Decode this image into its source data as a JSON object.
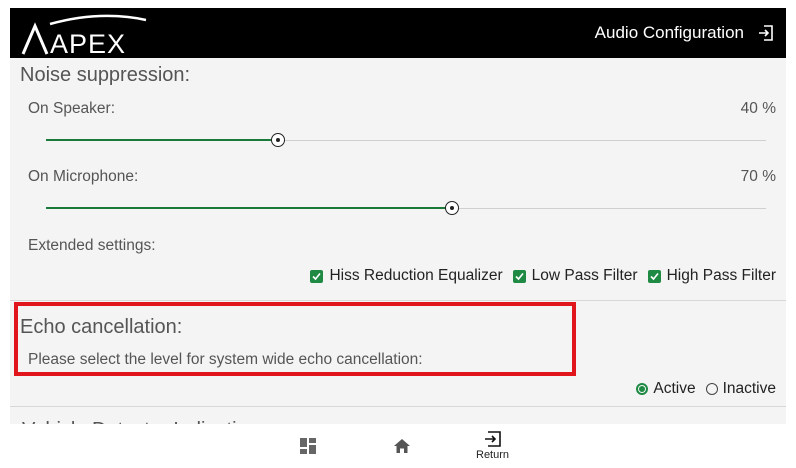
{
  "header": {
    "logo_text": "APEX",
    "title": "Audio Configuration",
    "exit_icon": "exit-icon"
  },
  "noise_suppression": {
    "title": "Noise suppression:",
    "speaker": {
      "label": "On Speaker:",
      "value_text": "40 %",
      "level": 0.4
    },
    "microphone": {
      "label": "On Microphone:",
      "value_text": "70 %",
      "level": 0.7
    },
    "extended_label": "Extended settings:",
    "options": [
      {
        "label": "Hiss Reduction Equalizer",
        "checked": true
      },
      {
        "label": "Low Pass Filter",
        "checked": true
      },
      {
        "label": "High Pass Filter",
        "checked": true
      }
    ]
  },
  "echo_cancellation": {
    "title": "Echo cancellation:",
    "description": "Please select the level for system wide echo cancellation:",
    "options": [
      {
        "label": "Active",
        "selected": true
      },
      {
        "label": "Inactive",
        "selected": false
      }
    ]
  },
  "next_section_partial": "Vehicle Detector Indication",
  "bottom_nav": {
    "dashboard_icon": "dashboard-icon",
    "home_icon": "home-icon",
    "return_label": "Return"
  },
  "colors": {
    "accent": "#1f8a44",
    "highlight": "#e1161d",
    "header_bg": "#000000"
  }
}
